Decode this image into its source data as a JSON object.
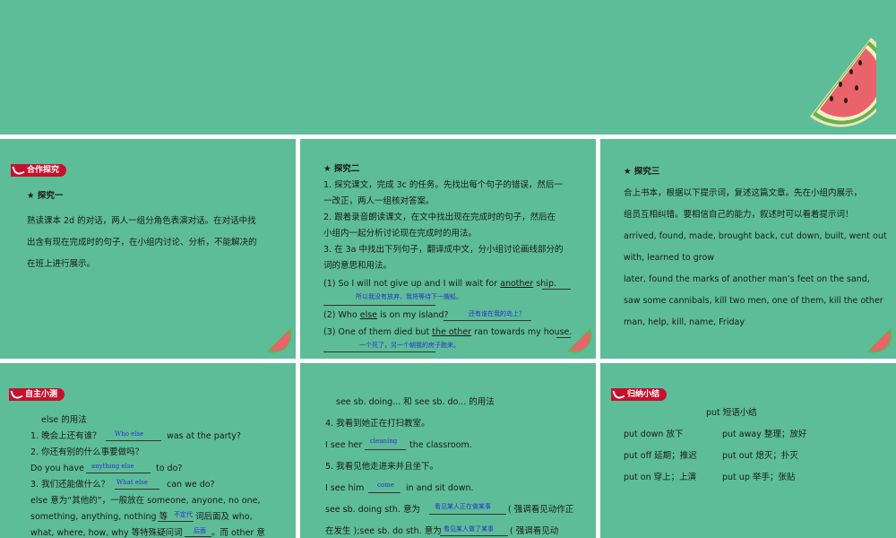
{
  "slide1": {
    "tag": "合作探究",
    "heading": "★ 探究一",
    "lines": [
      "熟读课本 2d 的对话，两人一组分角色表演对话。在对话中找",
      "出含有现在完成时的句子，在小组内讨论、分析，不能解决的",
      "在班上进行展示。"
    ]
  },
  "slide2": {
    "heading": "★ 探究二",
    "lines": [
      "1. 探究课文，完成 3c 的任务。先找出每个句子的错误，然后一",
      "一改正，两人一组核对答案。",
      "2. 跟着录音朗读课文，在文中找出现在完成时的句子，然后在",
      "小组内一起分析讨论现在完成时的用法。",
      "3. 在 3a 中找出下列句子，翻译成中文，分小组讨论画线部分的",
      "词的意思和用法。"
    ],
    "q1_a": "(1) So I will not give up and I will wait for ",
    "q1_u": "another",
    "q1_b": " ship.",
    "q1_ans": "所以我没有放弃，我将等待下一艘船。",
    "q2_a": "(2) Who ",
    "q2_u": "else",
    "q2_b": " is on my island?",
    "q2_ans": "还有谁在我的岛上？",
    "q3_a": "(3) One of them died but ",
    "q3_u": "the other",
    "q3_b": " ran towards my house.",
    "q3_ans": "一个死了，另一个朝我的房子跑来。"
  },
  "slide3": {
    "heading": "★ 探究三",
    "lines": [
      "合上书本，根据以下提示词，复述这篇文章。先在小组内展示，",
      "组员互相纠错。要相信自己的能力，叙述时可以看着提示词！",
      "arrived, found, made, brought back, cut down, built, went out",
      "with, learned to grow",
      "later, found the marks of another man’s feet on the sand,",
      "saw some cannibals, kill two men, one of them, kill the other",
      "man, help, kill, name, Friday"
    ]
  },
  "slide4": {
    "tag": "自主小测",
    "title": "else 的用法",
    "q1": "1.  晚会上还有谁？",
    "q1_ans": "Who else",
    "q1_end": "was at the party?",
    "q2": "2.  你还有别的什么事要做吗？",
    "q2_pre": "Do you have",
    "q2_ans": "anything else",
    "q2_end": "to do?",
    "q3": "3.  我们还能做什么？",
    "q3_ans": "What else",
    "q3_end": "can we do?",
    "n1": "else 意为“其他的”，一般放在 someone, anyone, no one,",
    "n2_a": "something, anything, nothing 等",
    "n2_ans": "不定代",
    "n2_b": "词后面及 who,",
    "n3_a": "what, where, how, why 等特殊疑问词",
    "n3_ans": "后面",
    "n3_b": "。而 other 意"
  },
  "slide5": {
    "title": "see sb. doing... 和 see sb. do... 的用法",
    "q4": "4.  我看到她正在打扫教室。",
    "q4_pre": "I see her",
    "q4_ans": "cleaning",
    "q4_end": "the classroom.",
    "q5": "5.  我看见他走进来并且坐下。",
    "q5_pre": "I see him",
    "q5_ans": "come",
    "q5_end": "in and sit down.",
    "n1_a": "see sb. doing sth. 意为",
    "n1_ans": "看见某人正在做某事",
    "n1_b": "( 强调看见动作正",
    "n2_a": "在发生 );see sb. do sth. 意为",
    "n2_ans": "看见某人做了某事",
    "n2_b": "( 强调看见动"
  },
  "slide6": {
    "tag": "归纳小结",
    "title": "put 短语小结",
    "rows": [
      [
        "put down  放下",
        "put away  整理；放好"
      ],
      [
        "put off  延期；推迟",
        "put out  熄灭；扑灭"
      ],
      [
        "put on  穿上；上演",
        "put up  举手；张贴"
      ]
    ]
  }
}
